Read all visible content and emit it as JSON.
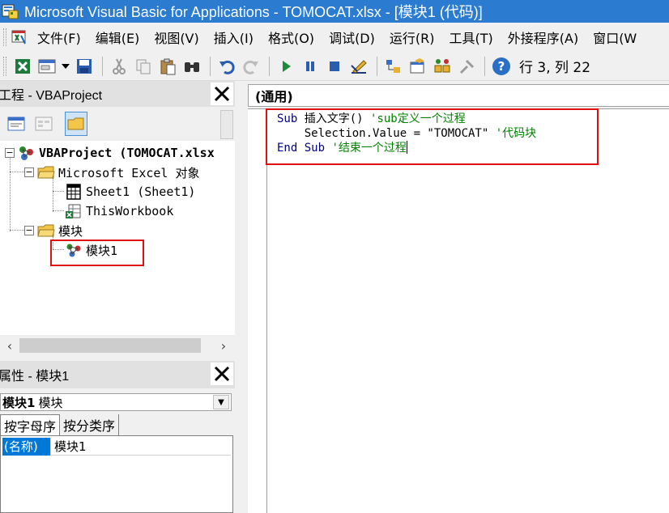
{
  "window": {
    "title": "Microsoft Visual Basic for Applications - TOMOCAT.xlsx - [模块1 (代码)]"
  },
  "menu": {
    "items": [
      "文件(F)",
      "编辑(E)",
      "视图(V)",
      "插入(I)",
      "格式(O)",
      "调试(D)",
      "运行(R)",
      "工具(T)",
      "外接程序(A)",
      "窗口(W"
    ]
  },
  "toolbar": {
    "icons": [
      "view-excel-icon",
      "insert-userform-icon",
      "dropdown-icon",
      "save-icon",
      "cut-icon",
      "copy-icon",
      "paste-icon",
      "find-icon",
      "undo-icon",
      "redo-icon",
      "run-icon",
      "break-icon",
      "reset-icon",
      "design-mode-icon",
      "project-explorer-icon",
      "properties-window-icon",
      "object-browser-icon",
      "toolbox-icon",
      "help-icon"
    ],
    "cursor_position": "行 3, 列 22"
  },
  "project": {
    "title": "工程 - VBAProject",
    "tree": {
      "root": "VBAProject (TOMOCAT.xlsx",
      "folder1": "Microsoft Excel 对象",
      "sheet1": "Sheet1 (Sheet1)",
      "workbook": "ThisWorkbook",
      "folder2": "模块",
      "module1": "模块1"
    }
  },
  "properties": {
    "title": "属性 - 模块1",
    "selected_object": "模块1",
    "selected_type": "模块",
    "tabs": [
      "按字母序",
      "按分类序"
    ],
    "rows": [
      {
        "key": "(名称)",
        "value": "模块1"
      }
    ]
  },
  "code": {
    "object_combo": "(通用)",
    "lines": [
      {
        "kw": "Sub ",
        "text": "插入文字() ",
        "comment": "'sub定义一个过程"
      },
      {
        "kw": "",
        "text": "    Selection.Value = \"TOMOCAT\" ",
        "comment": "'代码块"
      },
      {
        "kw": "End Sub ",
        "text": "",
        "comment": "'结束一个过程"
      }
    ]
  },
  "colors": {
    "titlebar": "#2b7bd0",
    "keyword": "#00007f",
    "comment": "#008000",
    "highlight": "#e01010",
    "selection": "#0078d7"
  }
}
